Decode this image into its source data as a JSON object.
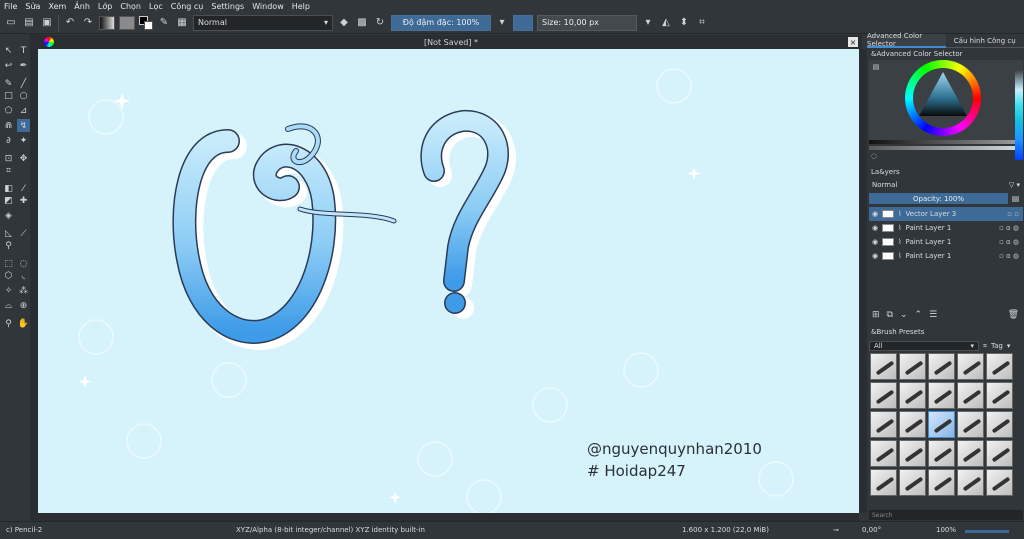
{
  "menu": [
    "File",
    "Sửa",
    "Xem",
    "Ảnh",
    "Lớp",
    "Chọn",
    "Lọc",
    "Công cụ",
    "Settings",
    "Window",
    "Help"
  ],
  "toolbar": {
    "blend_mode": "Normal",
    "opacity_label": "Độ đậm đặc: 100%",
    "size_label": "Size: 10,00 px"
  },
  "document": {
    "title": "[Not Saved]  *"
  },
  "canvas": {
    "watermark_line1": "@nguyenquynhan2010",
    "watermark_line2": "# Hoidap247",
    "background_color": "#d6f3fc",
    "glyph_color": "#7cc4f0"
  },
  "dock": {
    "tab_color_selector": "Advanced Color Selector",
    "tab_tool_options": "Cấu hình Công cụ",
    "color_panel_title": "&Advanced Color Selector",
    "layers_title": "La&yers",
    "layers_blend": "Normal",
    "layers_opacity": "Opacity: 100%",
    "layers": [
      {
        "name": "Vector Layer 3",
        "selected": true
      },
      {
        "name": "Paint Layer 1",
        "selected": false
      },
      {
        "name": "Paint Layer 1",
        "selected": false
      },
      {
        "name": "Paint Layer 1",
        "selected": false
      }
    ],
    "brush_title": "&Brush Presets",
    "brush_filter": "All",
    "brush_tag": "Tag",
    "brush_search_placeholder": "Search"
  },
  "status": {
    "tool": "c) Pencil-2",
    "colorspace": "XYZ/Alpha (8-bit integer/channel)  XYZ identity built-in",
    "dimensions": "1.600 x 1.200 (22,0 MiB)",
    "rotation": "0,00°",
    "zoom": "100%"
  }
}
